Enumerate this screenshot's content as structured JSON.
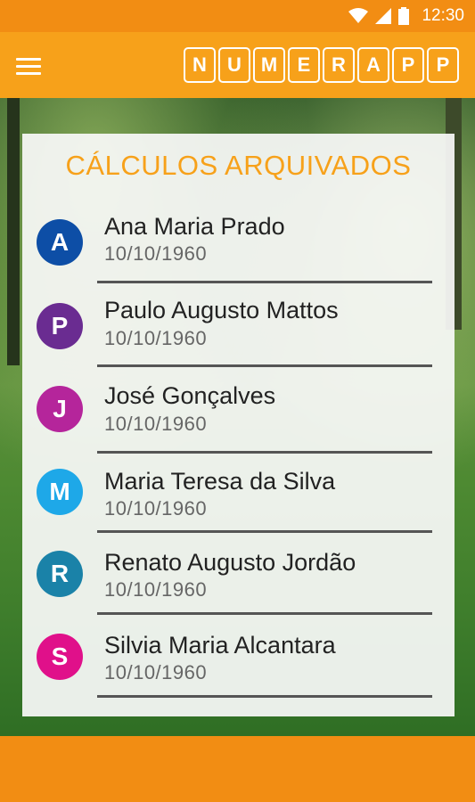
{
  "status_bar": {
    "time": "12:30",
    "icons": [
      "wifi-icon",
      "signal-icon",
      "battery-icon"
    ]
  },
  "app_bar": {
    "menu_icon": "hamburger-menu-icon",
    "logo_letters": [
      "N",
      "U",
      "M",
      "E",
      "R",
      "A",
      "P",
      "P"
    ]
  },
  "card": {
    "title": "CÁLCULOS ARQUIVADOS"
  },
  "items": [
    {
      "initial": "A",
      "name": "Ana Maria Prado",
      "date": "10/10/1960",
      "color": "#0d4ea6"
    },
    {
      "initial": "P",
      "name": "Paulo Augusto Mattos",
      "date": "10/10/1960",
      "color": "#6a2c91"
    },
    {
      "initial": "J",
      "name": "José Gonçalves",
      "date": "10/10/1960",
      "color": "#b5259b"
    },
    {
      "initial": "M",
      "name": "Maria Teresa da Silva",
      "date": "10/10/1960",
      "color": "#1ea8e8"
    },
    {
      "initial": "R",
      "name": "Renato Augusto Jordão",
      "date": "10/10/1960",
      "color": "#1a82a8"
    },
    {
      "initial": "S",
      "name": "Silvia Maria Alcantara",
      "date": "10/10/1960",
      "color": "#e0108a"
    }
  ],
  "colors": {
    "accent": "#f7a11a",
    "status_bar": "#f28d13"
  }
}
